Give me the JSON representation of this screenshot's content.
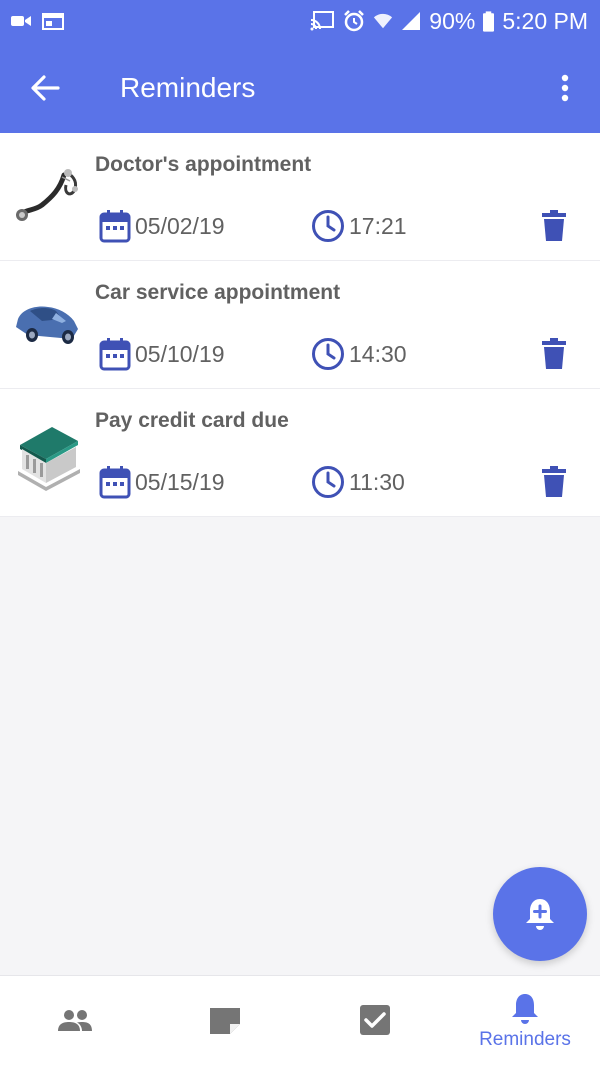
{
  "status_bar": {
    "battery": "90%",
    "time": "5:20 PM"
  },
  "app_bar": {
    "title": "Reminders"
  },
  "reminders": [
    {
      "title": "Doctor's appointment",
      "date": "05/02/19",
      "time": "17:21",
      "icon": "stethoscope-icon"
    },
    {
      "title": "Car service appointment",
      "date": "05/10/19",
      "time": "14:30",
      "icon": "car-icon"
    },
    {
      "title": "Pay credit card due",
      "date": "05/15/19",
      "time": "11:30",
      "icon": "bank-icon"
    }
  ],
  "bottom_nav": {
    "items": [
      {
        "icon": "people-icon",
        "label": ""
      },
      {
        "icon": "note-icon",
        "label": ""
      },
      {
        "icon": "checkbox-icon",
        "label": ""
      },
      {
        "icon": "bell-icon",
        "label": "Reminders",
        "active": true
      }
    ]
  },
  "colors": {
    "primary": "#5a73e8",
    "accent_dark": "#3f51b5",
    "text": "#616161",
    "nav_inactive": "#757575"
  }
}
